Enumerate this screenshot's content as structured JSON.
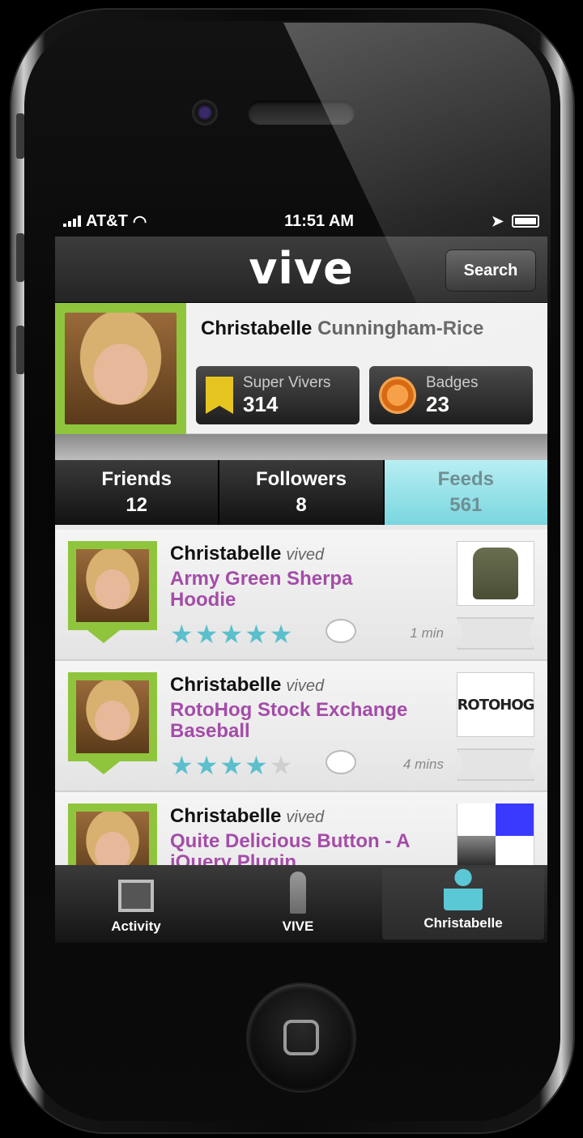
{
  "status": {
    "carrier": "AT&T",
    "time": "11:51 AM"
  },
  "header": {
    "logo": "vive",
    "search_label": "Search"
  },
  "profile": {
    "first_name": "Christabelle",
    "last_name": "Cunningham-Rice",
    "stats": [
      {
        "label": "Super Vivers",
        "value": "314"
      },
      {
        "label": "Badges",
        "value": "23"
      }
    ]
  },
  "tabs": [
    {
      "label": "Friends",
      "count": "12"
    },
    {
      "label": "Followers",
      "count": "8"
    },
    {
      "label": "Feeds",
      "count": "561"
    }
  ],
  "feed": [
    {
      "user": "Christabelle",
      "action": "vived",
      "title": "Army Green Sherpa Hoodie",
      "rating": 5,
      "time": "1 min"
    },
    {
      "user": "Christabelle",
      "action": "vived",
      "title": "RotoHog Stock Exchange Baseball",
      "rating": 4,
      "time": "4 mins",
      "thumb_text": "ROTOHOG"
    },
    {
      "user": "Christabelle",
      "action": "vived",
      "title": "Quite Delicious Button - A jQuery Plugin"
    }
  ],
  "tabbar": [
    {
      "label": "Activity",
      "icon": "activity-icon"
    },
    {
      "label": "VIVE",
      "icon": "vive-person-icon"
    },
    {
      "label": "Christabelle",
      "icon": "profile-person-icon"
    }
  ],
  "colors": {
    "accent_green": "#8fc53d",
    "accent_cyan": "#5bbfcc",
    "title_purple": "#a44ca8"
  }
}
